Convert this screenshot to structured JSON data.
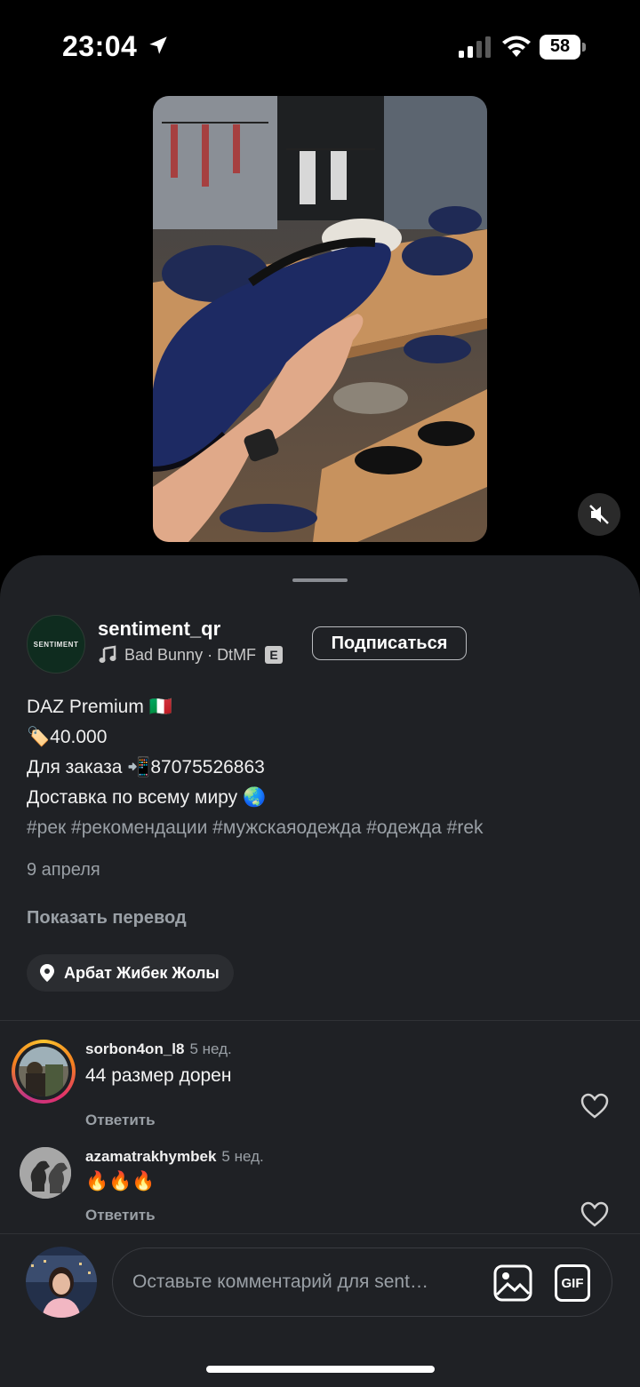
{
  "status_bar": {
    "time": "23:04",
    "battery": "58",
    "icons": [
      "location-arrow-icon",
      "signal-icon",
      "wifi-icon",
      "battery-icon"
    ]
  },
  "media": {
    "mute_icon": "muted-speaker-icon"
  },
  "post": {
    "username": "sentiment_qr",
    "avatar_text": "SENTIMENT",
    "music": "Bad Bunny · DtMF",
    "explicit": "E",
    "follow_label": "Подписаться",
    "caption_lines": [
      "DAZ Premium 🇮🇹",
      "🏷️40.000",
      "Для заказа 📲87075526863",
      "Доставка по всему миру 🌏"
    ],
    "hashtags": "#рек #рекомендации #мужскаяодежда #одежда #rek",
    "date": "9 апреля",
    "translate_label": "Показать перевод",
    "location": "Арбат Жибек Жолы"
  },
  "comments": [
    {
      "username": "sorbon4on_l8",
      "time": "5 нед.",
      "text": "44 размер дорен",
      "reply": "Ответить"
    },
    {
      "username": "azamatrakhymbek",
      "time": "5 нед.",
      "text": "🔥🔥🔥",
      "reply": "Ответить"
    }
  ],
  "composer": {
    "placeholder": "Оставьте комментарий для sent…",
    "gif_label": "GIF"
  },
  "colors": {
    "sheet": "#1f2125",
    "muted_text": "#9aa0a6",
    "story_ring": "#e1306c"
  }
}
